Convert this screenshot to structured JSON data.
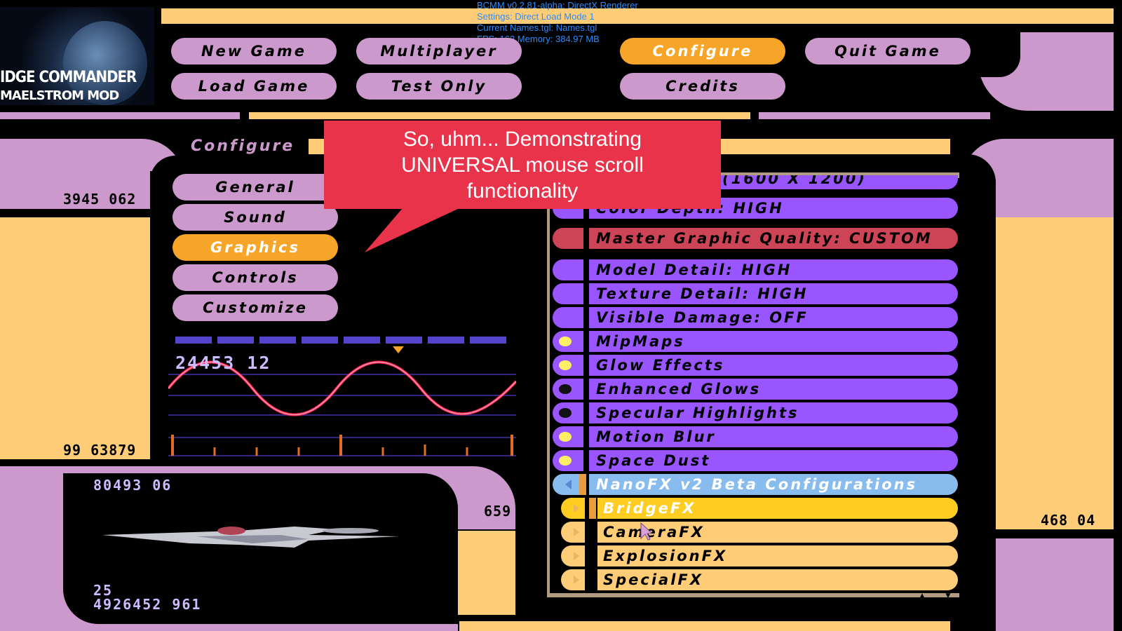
{
  "debug": {
    "line1": "BCMM v0.2.81-alpha: DirectX Renderer",
    "line2": "Settings: Direct Load   Mode 1",
    "line3": "Current Names.tgl: Names.tgl",
    "line4": "FPS: 162 Memory: 384.97 MB"
  },
  "logo": {
    "line1": "IDGE COMMANDER",
    "line2": "MAELSTROM MOD"
  },
  "top_menu": {
    "new_game": "New Game",
    "load_game": "Load Game",
    "multiplayer": "Multiplayer",
    "test_only": "Test Only",
    "configure": "Configure",
    "credits": "Credits",
    "quit_game": "Quit Game"
  },
  "panel_title": "Configure",
  "side_menu": {
    "general": "General",
    "sound": "Sound",
    "graphics": "Graphics",
    "controls": "Controls",
    "customize": "Customize"
  },
  "numbers": {
    "left_top": "3945 062",
    "left_bottom": "99 63879",
    "scope": "24453 12",
    "ship_top": "80493 06",
    "ship_mid": "659",
    "ship_line1": "25",
    "ship_line2": "4926452 961",
    "right": "468 04"
  },
  "callout": "So, uhm... Demonstrating UNIVERSAL mouse scroll functionality",
  "graphics_options": {
    "resolution": "(1600 X 1200)",
    "color_depth": "Color Depth: HIGH",
    "master_quality": "Master Graphic Quality: CUSTOM",
    "model_detail": "Model Detail: HIGH",
    "texture_detail": "Texture Detail: HIGH",
    "visible_damage": "Visible Damage: OFF",
    "mipmaps": "MipMaps",
    "glow_effects": "Glow Effects",
    "enhanced_glows": "Enhanced Glows",
    "specular_highlights": "Specular Highlights",
    "motion_blur": "Motion Blur",
    "space_dust": "Space Dust",
    "nanofx": "NanoFX v2 Beta Configurations",
    "bridgefx": "BridgeFX",
    "camerafx": "CameraFX",
    "explosionfx": "ExplosionFX",
    "specialfx": "SpecialFX"
  },
  "toggles": {
    "mipmaps": true,
    "glow_effects": true,
    "enhanced_glows": false,
    "specular_highlights": false,
    "motion_blur": true,
    "space_dust": true
  },
  "colors": {
    "lcars_pink": "#cc99cc",
    "lcars_tan": "#ffcc77",
    "lcars_orange": "#f7a528",
    "option_purple": "#9955ff",
    "master_red": "#cc4455",
    "nano_blue": "#88bbee",
    "selected_yellow": "#ffcc22",
    "callout_red": "#e8334a"
  }
}
